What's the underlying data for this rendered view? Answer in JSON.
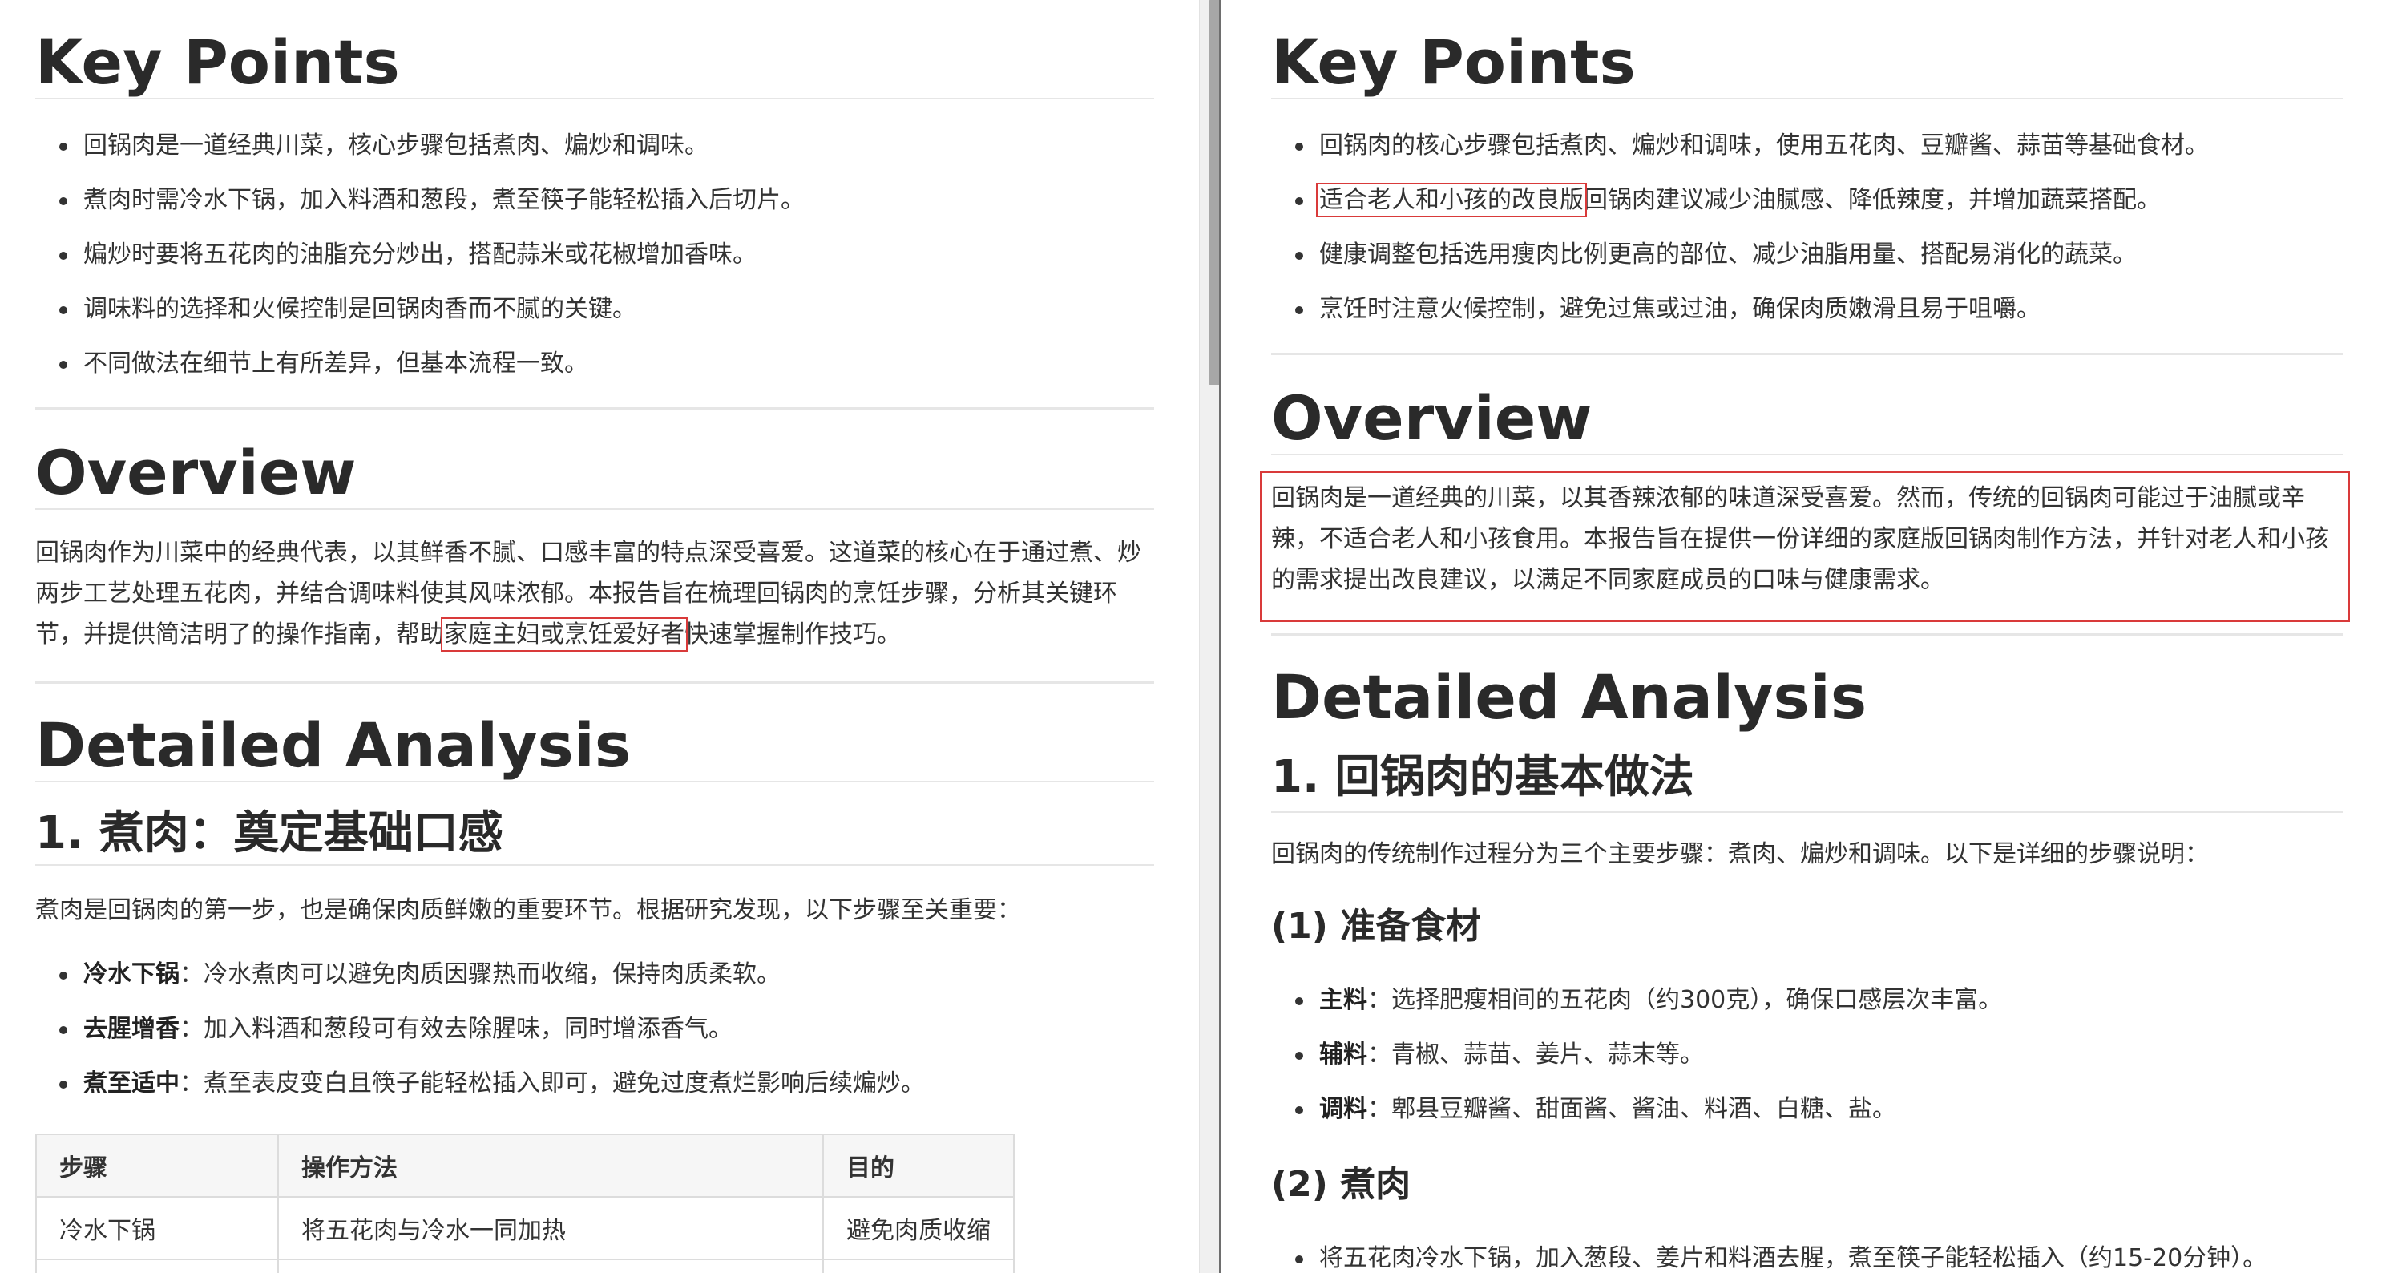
{
  "left": {
    "key_points": {
      "title": "Key Points",
      "items": [
        "回锅肉是一道经典川菜，核心步骤包括煮肉、煸炒和调味。",
        "煮肉时需冷水下锅，加入料酒和葱段，煮至筷子能轻松插入后切片。",
        "煸炒时要将五花肉的油脂充分炒出，搭配蒜米或花椒增加香味。",
        "调味料的选择和火候控制是回锅肉香而不腻的关键。",
        "不同做法在细节上有所差异，但基本流程一致。"
      ]
    },
    "overview": {
      "title": "Overview",
      "text_before": "回锅肉作为川菜中的经典代表，以其鲜香不腻、口感丰富的特点深受喜爱。这道菜的核心在于通过煮、炒两步工艺处理五花肉，并结合调味料使其风味浓郁。本报告旨在梳理回锅肉的烹饪步骤，分析其关键环节，并提供简洁明了的操作指南，帮助",
      "text_highlight": "家庭主妇或烹饪爱好者",
      "text_after": "快速掌握制作技巧。"
    },
    "detailed": {
      "title": "Detailed Analysis",
      "subtitle": "1. 煮肉：奠定基础口感",
      "intro": "煮肉是回锅肉的第一步，也是确保肉质鲜嫩的重要环节。根据研究发现，以下步骤至关重要：",
      "items": [
        {
          "term": "冷水下锅",
          "desc": "：冷水煮肉可以避免肉质因骤热而收缩，保持肉质柔软。"
        },
        {
          "term": "去腥增香",
          "desc": "：加入料酒和葱段可有效去除腥味，同时增添香气。"
        },
        {
          "term": "煮至适中",
          "desc": "：煮至表皮变白且筷子能轻松插入即可，避免过度煮烂影响后续煸炒。"
        }
      ],
      "table": {
        "headers": [
          "步骤",
          "操作方法",
          "目的"
        ],
        "rows": [
          [
            "冷水下锅",
            "将五花肉与冷水一同加热",
            "避免肉质收缩"
          ]
        ]
      }
    }
  },
  "right": {
    "key_points": {
      "title": "Key Points",
      "items": [
        {
          "before": "回锅肉的核心步骤包括煮肉、煸炒和调味，使用五花肉、豆瓣酱、蒜苗等基础食材。",
          "highlight": "",
          "after": ""
        },
        {
          "before": "",
          "highlight": "适合老人和小孩的改良版",
          "after": "回锅肉建议减少油腻感、降低辣度，并增加蔬菜搭配。"
        },
        {
          "before": "健康调整包括选用瘦肉比例更高的部位、减少油脂用量、搭配易消化的蔬菜。",
          "highlight": "",
          "after": ""
        },
        {
          "before": "烹饪时注意火候控制，避免过焦或过油，确保肉质嫩滑且易于咀嚼。",
          "highlight": "",
          "after": ""
        }
      ]
    },
    "overview": {
      "title": "Overview",
      "text": "回锅肉是一道经典的川菜，以其香辣浓郁的味道深受喜爱。然而，传统的回锅肉可能过于油腻或辛辣，不适合老人和小孩食用。本报告旨在提供一份详细的家庭版回锅肉制作方法，并针对老人和小孩的需求提出改良建议，以满足不同家庭成员的口味与健康需求。"
    },
    "detailed": {
      "title": "Detailed Analysis",
      "subtitle": "1. 回锅肉的基本做法",
      "intro": "回锅肉的传统制作过程分为三个主要步骤：煮肉、煸炒和调味。以下是详细的步骤说明：",
      "step1_title": "(1) 准备食材",
      "step1_items": [
        {
          "term": "主料",
          "desc": "：选择肥瘦相间的五花肉（约300克），确保口感层次丰富。"
        },
        {
          "term": "辅料",
          "desc": "：青椒、蒜苗、姜片、蒜末等。"
        },
        {
          "term": "调料",
          "desc": "：郫县豆瓣酱、甜面酱、酱油、料酒、白糖、盐。"
        }
      ],
      "step2_title": "(2) 煮肉",
      "step2_items": [
        "将五花肉冷水下锅，加入葱段、姜片和料酒去腥，煮至筷子能轻松插入（约15-20分钟）。"
      ]
    }
  }
}
